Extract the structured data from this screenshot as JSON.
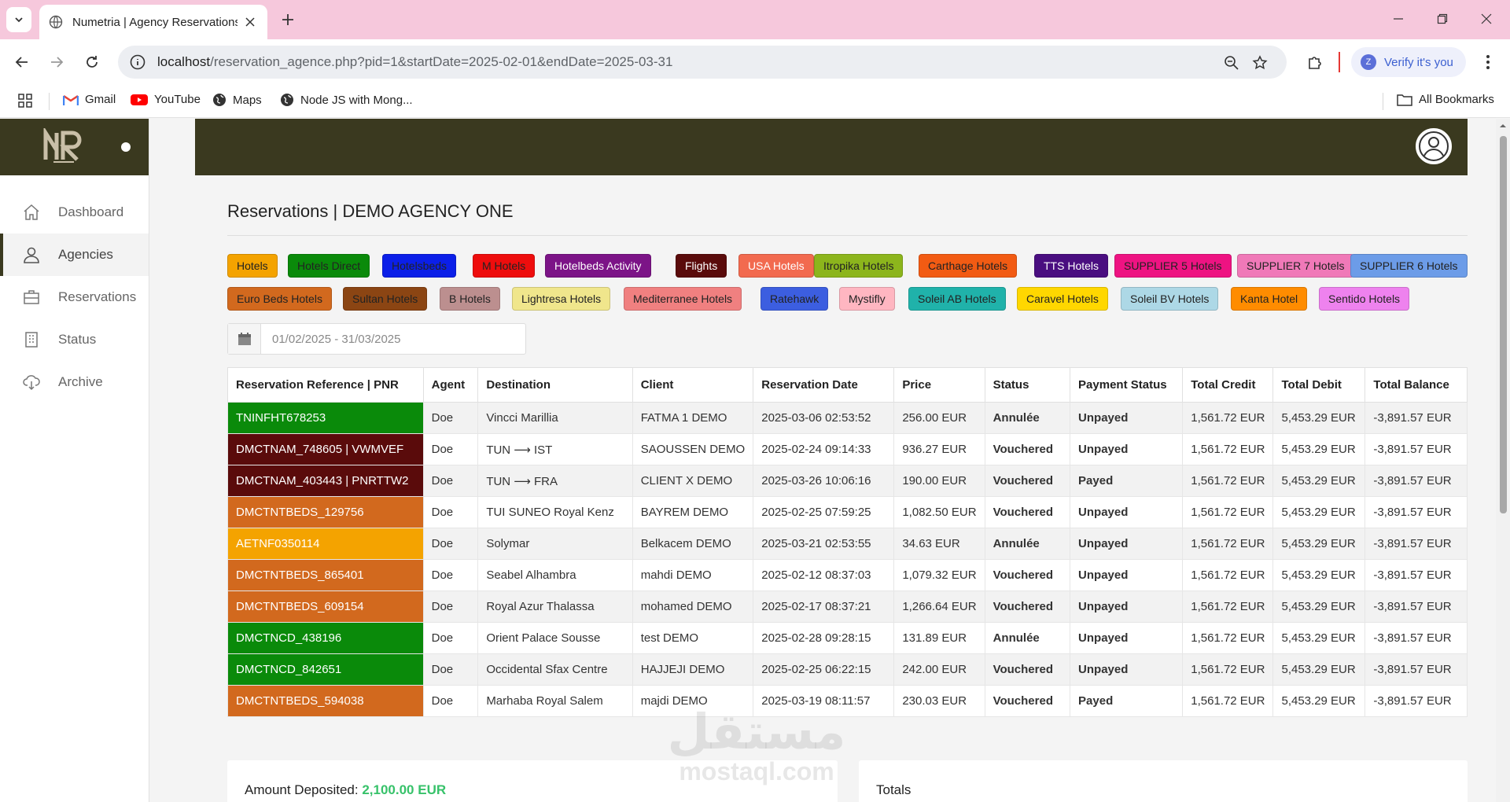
{
  "browser": {
    "tab_title": "Numetria | Agency Reservations",
    "url_host": "localhost",
    "url_path": "/reservation_agence.php?pid=1&startDate=2025-02-01&endDate=2025-03-31",
    "verify_label": "Verify it's you",
    "verify_avatar": "Z",
    "bookmarks": [
      "Gmail",
      "YouTube",
      "Maps",
      "Node JS with Mong..."
    ],
    "all_bookmarks": "All Bookmarks"
  },
  "sidebar": {
    "items": [
      {
        "label": "Dashboard",
        "icon": "home-icon"
      },
      {
        "label": "Agencies",
        "icon": "user-icon"
      },
      {
        "label": "Reservations",
        "icon": "briefcase-icon"
      },
      {
        "label": "Status",
        "icon": "building-icon"
      },
      {
        "label": "Archive",
        "icon": "cloud-download-icon"
      }
    ],
    "active_index": 1
  },
  "page": {
    "title": "Reservations | DEMO AGENCY ONE",
    "date_range": "01/02/2025 - 31/03/2025"
  },
  "suppliers": [
    {
      "label": "Hotels",
      "bg": "#f4a300",
      "fg": "#222"
    },
    {
      "label": "Hotels Direct",
      "bg": "#0a8a0a",
      "fg": "#222"
    },
    {
      "label": "Hotelsbeds",
      "bg": "#0b1fe8",
      "fg": "#222"
    },
    {
      "label": "M Hotels",
      "bg": "#ee0d0d",
      "fg": "#222"
    },
    {
      "label": "Hotelbeds Activity",
      "bg": "#7c1487",
      "fg": "#fff"
    },
    {
      "label": "Flights",
      "bg": "#5a0b0b",
      "fg": "#fff"
    },
    {
      "label": "USA Hotels",
      "bg": "#f26a4f",
      "fg": "#fff"
    },
    {
      "label": "Itropika Hotels",
      "bg": "#8cb51c",
      "fg": "#222"
    },
    {
      "label": "Carthage Hotels",
      "bg": "#f25b13",
      "fg": "#222"
    },
    {
      "label": "TTS Hotels",
      "bg": "#4a0e80",
      "fg": "#fff"
    },
    {
      "label": "SUPPLIER 5 Hotels",
      "bg": "#ee1382",
      "fg": "#222"
    },
    {
      "label": "SUPPLIER 7 Hotels",
      "bg": "#f079b8",
      "fg": "#222"
    },
    {
      "label": "SUPPLIER 6 Hotels",
      "bg": "#6c9ce8",
      "fg": "#222"
    },
    {
      "label": "Euro Beds Hotels",
      "bg": "#d2691e",
      "fg": "#222"
    },
    {
      "label": "Sultan Hotels",
      "bg": "#8b4513",
      "fg": "#222"
    },
    {
      "label": "B Hotels",
      "bg": "#bc8f8f",
      "fg": "#222"
    },
    {
      "label": "Lightresa Hotels",
      "bg": "#f0e68c",
      "fg": "#222"
    },
    {
      "label": "Mediterranee Hotels",
      "bg": "#f08080",
      "fg": "#222"
    },
    {
      "label": "Ratehawk",
      "bg": "#3c5ee0",
      "fg": "#222"
    },
    {
      "label": "Mystifly",
      "bg": "#ffb6c1",
      "fg": "#222"
    },
    {
      "label": "Soleil AB Hotels",
      "bg": "#20b2aa",
      "fg": "#222"
    },
    {
      "label": "Caravel Hotels",
      "bg": "#ffd700",
      "fg": "#222"
    },
    {
      "label": "Soleil BV Hotels",
      "bg": "#add8e6",
      "fg": "#222"
    },
    {
      "label": "Kanta Hotel",
      "bg": "#ff8c00",
      "fg": "#222"
    },
    {
      "label": "Sentido Hotels",
      "bg": "#ee82ee",
      "fg": "#222"
    }
  ],
  "table": {
    "headers": [
      "Reservation Reference | PNR",
      "Agent",
      "Destination",
      "Client",
      "Reservation Date",
      "Price",
      "Status",
      "Payment Status",
      "Total Credit",
      "Total Debit",
      "Total Balance"
    ],
    "rows": [
      {
        "ref": "TNINFHT678253",
        "ref_color": "#0a8a0a",
        "agent": "Doe",
        "destination": "Vincci Marillia",
        "client": "FATMA 1 DEMO",
        "date": "2025-03-06 02:53:52",
        "price": "256.00 EUR",
        "status": "Annulée",
        "payment": "Unpayed",
        "credit": "1,561.72 EUR",
        "debit": "5,453.29 EUR",
        "balance": "-3,891.57 EUR"
      },
      {
        "ref": "DMCTNAM_748605 | VWMVEF",
        "ref_color": "#5a0b0b",
        "agent": "Doe",
        "destination": "TUN ⟶ IST",
        "client": "SAOUSSEN DEMO",
        "date": "2025-02-24 09:14:33",
        "price": "936.27 EUR",
        "status": "Vouchered",
        "payment": "Unpayed",
        "credit": "1,561.72 EUR",
        "debit": "5,453.29 EUR",
        "balance": "-3,891.57 EUR"
      },
      {
        "ref": "DMCTNAM_403443 | PNRTTW2",
        "ref_color": "#5a0b0b",
        "agent": "Doe",
        "destination": "TUN ⟶ FRA",
        "client": "CLIENT X DEMO",
        "date": "2025-03-26 10:06:16",
        "price": "190.00 EUR",
        "status": "Vouchered",
        "payment": "Payed",
        "credit": "1,561.72 EUR",
        "debit": "5,453.29 EUR",
        "balance": "-3,891.57 EUR"
      },
      {
        "ref": "DMCTNTBEDS_129756",
        "ref_color": "#d2691e",
        "agent": "Doe",
        "destination": "TUI SUNEO Royal Kenz",
        "client": "BAYREM DEMO",
        "date": "2025-02-25 07:59:25",
        "price": "1,082.50 EUR",
        "status": "Vouchered",
        "payment": "Unpayed",
        "credit": "1,561.72 EUR",
        "debit": "5,453.29 EUR",
        "balance": "-3,891.57 EUR"
      },
      {
        "ref": "AETNF0350114",
        "ref_color": "#f4a300",
        "agent": "Doe",
        "destination": "Solymar",
        "client": "Belkacem DEMO",
        "date": "2025-03-21 02:53:55",
        "price": "34.63 EUR",
        "status": "Annulée",
        "payment": "Unpayed",
        "credit": "1,561.72 EUR",
        "debit": "5,453.29 EUR",
        "balance": "-3,891.57 EUR"
      },
      {
        "ref": "DMCTNTBEDS_865401",
        "ref_color": "#d2691e",
        "agent": "Doe",
        "destination": "Seabel Alhambra",
        "client": "mahdi DEMO",
        "date": "2025-02-12 08:37:03",
        "price": "1,079.32 EUR",
        "status": "Vouchered",
        "payment": "Unpayed",
        "credit": "1,561.72 EUR",
        "debit": "5,453.29 EUR",
        "balance": "-3,891.57 EUR"
      },
      {
        "ref": "DMCTNTBEDS_609154",
        "ref_color": "#d2691e",
        "agent": "Doe",
        "destination": "Royal Azur Thalassa",
        "client": "mohamed DEMO",
        "date": "2025-02-17 08:37:21",
        "price": "1,266.64 EUR",
        "status": "Vouchered",
        "payment": "Unpayed",
        "credit": "1,561.72 EUR",
        "debit": "5,453.29 EUR",
        "balance": "-3,891.57 EUR"
      },
      {
        "ref": "DMCTNCD_438196",
        "ref_color": "#0a8a0a",
        "agent": "Doe",
        "destination": "Orient Palace Sousse",
        "client": "test DEMO",
        "date": "2025-02-28 09:28:15",
        "price": "131.89 EUR",
        "status": "Annulée",
        "payment": "Unpayed",
        "credit": "1,561.72 EUR",
        "debit": "5,453.29 EUR",
        "balance": "-3,891.57 EUR"
      },
      {
        "ref": "DMCTNCD_842651",
        "ref_color": "#0a8a0a",
        "agent": "Doe",
        "destination": "Occidental Sfax Centre",
        "client": "HAJJEJI DEMO",
        "date": "2025-02-25 06:22:15",
        "price": "242.00 EUR",
        "status": "Vouchered",
        "payment": "Unpayed",
        "credit": "1,561.72 EUR",
        "debit": "5,453.29 EUR",
        "balance": "-3,891.57 EUR"
      },
      {
        "ref": "DMCTNTBEDS_594038",
        "ref_color": "#d2691e",
        "agent": "Doe",
        "destination": "Marhaba Royal Salem",
        "client": "majdi DEMO",
        "date": "2025-03-19 08:11:57",
        "price": "230.03 EUR",
        "status": "Vouchered",
        "payment": "Payed",
        "credit": "1,561.72 EUR",
        "debit": "5,453.29 EUR",
        "balance": "-3,891.57 EUR"
      }
    ]
  },
  "summary": {
    "deposited_label": "Amount Deposited:",
    "deposited_value": "2,100.00 EUR",
    "totals_label": "Totals"
  },
  "watermark": {
    "arabic": "مستقل",
    "latin": "mostaql.com"
  }
}
